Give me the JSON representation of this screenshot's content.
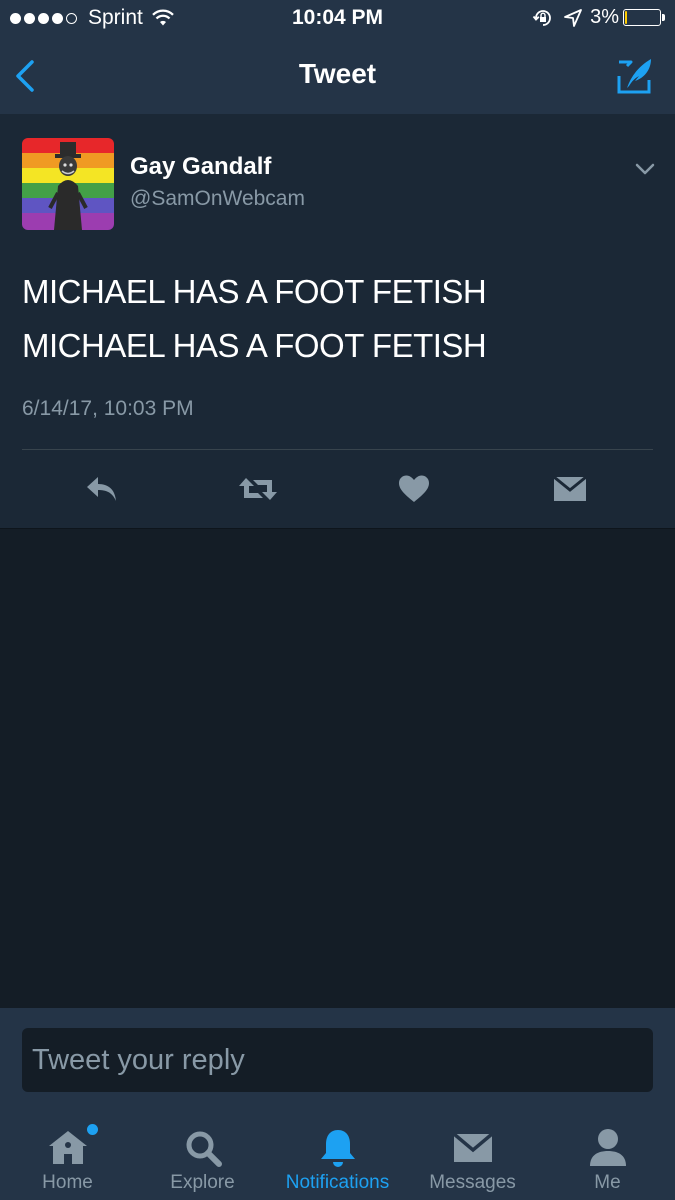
{
  "status_bar": {
    "carrier": "Sprint",
    "time": "10:04 PM",
    "battery_percent": "3%",
    "battery_level": 0.05,
    "signal_bars": 4
  },
  "nav": {
    "title": "Tweet",
    "back_icon": "chevron-left-icon",
    "compose_icon": "compose-quill-icon"
  },
  "tweet": {
    "author_name": "Gay Gandalf",
    "author_handle": "@SamOnWebcam",
    "text_lines": [
      "MICHAEL HAS A FOOT FETISH",
      "MICHAEL HAS A FOOT FETISH"
    ],
    "timestamp": "6/14/17, 10:03 PM",
    "actions": [
      "reply-icon",
      "retweet-icon",
      "like-heart-icon",
      "direct-message-icon"
    ]
  },
  "reply": {
    "placeholder": "Tweet your reply"
  },
  "tabs": [
    {
      "label": "Home",
      "icon": "home-icon",
      "active": false,
      "has_badge": true
    },
    {
      "label": "Explore",
      "icon": "search-icon",
      "active": false
    },
    {
      "label": "Notifications",
      "icon": "bell-icon",
      "active": true
    },
    {
      "label": "Messages",
      "icon": "envelope-icon",
      "active": false
    },
    {
      "label": "Me",
      "icon": "person-icon",
      "active": false
    }
  ],
  "colors": {
    "background": "#141d26",
    "bars": "#243447",
    "card": "#1b2836",
    "accent": "#1da1f2",
    "secondary_text": "#8899a6",
    "icon_gray": "#8899a6"
  }
}
